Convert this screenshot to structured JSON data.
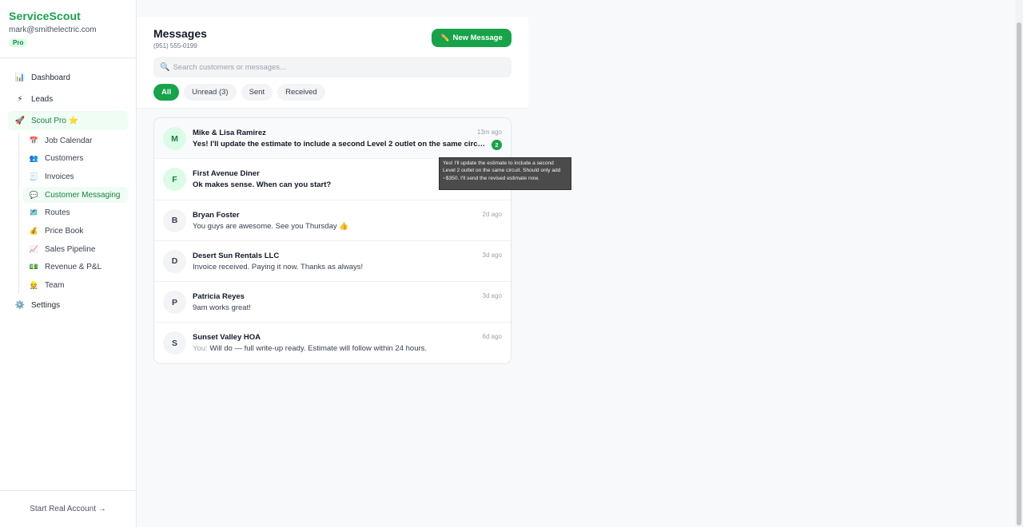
{
  "brand": {
    "title": "ServiceScout",
    "email": "mark@smithelectric.com",
    "plan": "Pro"
  },
  "nav": {
    "dashboard": {
      "label": "Dashboard",
      "icon": "📊"
    },
    "leads": {
      "label": "Leads",
      "icon": "⚡"
    },
    "scout_pro": {
      "label": "Scout Pro ⭐",
      "icon": "🚀"
    },
    "sub_items": [
      {
        "label": "Job Calendar",
        "icon": "📅"
      },
      {
        "label": "Customers",
        "icon": "👥"
      },
      {
        "label": "Invoices",
        "icon": "🧾"
      },
      {
        "label": "Customer Messaging",
        "icon": "💬"
      },
      {
        "label": "Routes",
        "icon": "🗺️"
      },
      {
        "label": "Price Book",
        "icon": "💰"
      },
      {
        "label": "Sales Pipeline",
        "icon": "📈"
      },
      {
        "label": "Revenue & P&L",
        "icon": "💵"
      },
      {
        "label": "Team",
        "icon": "👷"
      }
    ],
    "settings": {
      "label": "Settings",
      "icon": "⚙️"
    }
  },
  "footer": {
    "label": "Start Real Account →"
  },
  "header": {
    "title": "Messages",
    "phone": "(951) 555-0199",
    "new_button": "New Message",
    "new_button_icon": "✏️",
    "search_placeholder": "Search customers or messages...",
    "search_icon": "🔍"
  },
  "filters": [
    "All",
    "Unread (3)",
    "Sent",
    "Received"
  ],
  "conversations": [
    {
      "initial": "M",
      "name": "Mike & Lisa Ramirez",
      "time": "13m ago",
      "preview": "Yes! I'll update the estimate to include a second Level 2 outlet on the same circuit. Should only add ~$350. I'll send the revised estimate now.",
      "unread": "2",
      "you": ""
    },
    {
      "initial": "F",
      "name": "First Avenue Diner",
      "time": "",
      "preview": "Ok makes sense. When can you start?",
      "unread": "",
      "you": ""
    },
    {
      "initial": "B",
      "name": "Bryan Foster",
      "time": "2d ago",
      "preview": "You guys are awesome. See you Thursday 👍",
      "unread": "",
      "you": ""
    },
    {
      "initial": "D",
      "name": "Desert Sun Rentals LLC",
      "time": "3d ago",
      "preview": "Invoice received. Paying it now. Thanks as always!",
      "unread": "",
      "you": ""
    },
    {
      "initial": "P",
      "name": "Patricia Reyes",
      "time": "3d ago",
      "preview": "9am works great!",
      "unread": "",
      "you": ""
    },
    {
      "initial": "S",
      "name": "Sunset Valley HOA",
      "time": "6d ago",
      "preview": "Will do — full write-up ready. Estimate will follow within 24 hours.",
      "unread": "",
      "you": "You: "
    }
  ],
  "tooltip": "Yes! I'll update the estimate to include a second Level 2 outlet on the same circuit. Should only add ~$350. I'll send the revised estimate now.",
  "colors": {
    "accent": "#16a34a",
    "accent_light": "#dcfce7"
  }
}
